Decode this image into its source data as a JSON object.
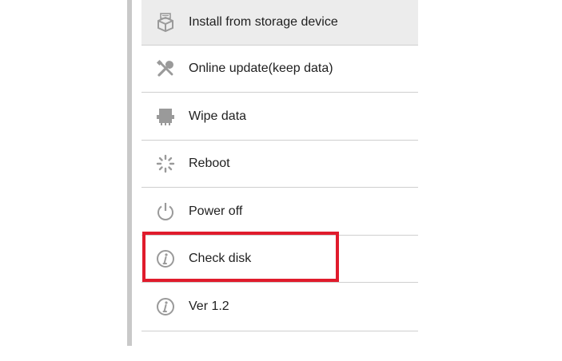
{
  "menu": {
    "items": [
      {
        "label": "Install from storage device",
        "icon": "package-icon",
        "selected": true
      },
      {
        "label": "Online update(keep data)",
        "icon": "tools-icon",
        "selected": false
      },
      {
        "label": "Wipe data",
        "icon": "printer-icon",
        "selected": false
      },
      {
        "label": "Reboot",
        "icon": "spinner-icon",
        "selected": false
      },
      {
        "label": "Power off",
        "icon": "power-icon",
        "selected": false
      },
      {
        "label": "Check disk",
        "icon": "info-icon",
        "selected": false
      },
      {
        "label": "Ver 1.2",
        "icon": "info-icon",
        "selected": false
      }
    ]
  },
  "annotation": {
    "highlighted_item": "Check disk",
    "color": "#e01b2c"
  },
  "colors": {
    "icon": "#9a9a9a",
    "selected_bg": "#ececec",
    "divider": "#cfcfcf",
    "text": "#1f1f1f"
  }
}
